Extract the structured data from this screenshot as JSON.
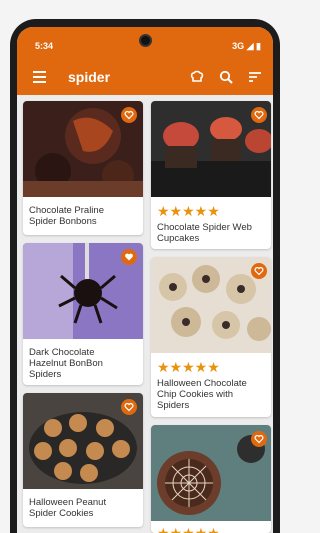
{
  "status": {
    "time": "5:34",
    "right": "3G ◢ ▮"
  },
  "appbar": {
    "title": "spider"
  },
  "colors": {
    "accent": "#e0690f",
    "star": "#e8920e"
  },
  "icons": [
    "menu-icon",
    "chef-hat-icon",
    "search-icon",
    "sort-icon",
    "heart-icon",
    "star-icon"
  ],
  "recipes": [
    {
      "title_lines": [
        "Chocolate Praline",
        "Spider Bonbons"
      ],
      "rating": null
    },
    {
      "title_lines": [
        "Chocolate Spider Web",
        "Cupcakes"
      ],
      "rating": "★★★★★"
    },
    {
      "title_lines": [
        "Dark Chocolate",
        "Hazelnut BonBon",
        "Spiders"
      ],
      "rating": null
    },
    {
      "title_lines": [
        "Halloween Chocolate",
        "Chip Cookies with",
        "Spiders"
      ],
      "rating": "★★★★★"
    },
    {
      "title_lines": [
        "Halloween Peanut",
        "Spider Cookies"
      ],
      "rating": null
    },
    {
      "title_lines": [],
      "rating": "★★★★★"
    }
  ]
}
